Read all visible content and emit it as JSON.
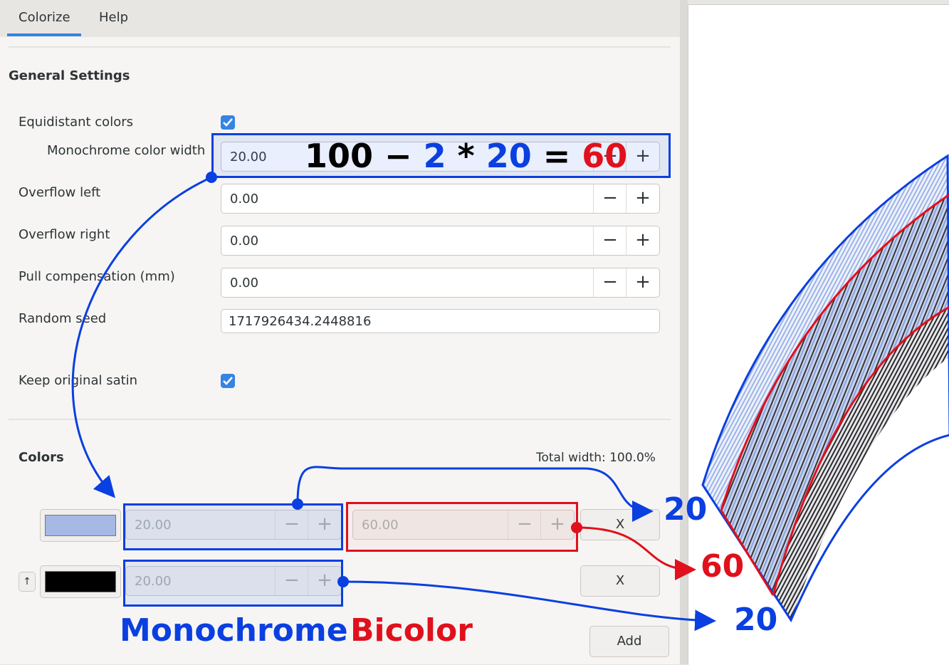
{
  "tabs": [
    {
      "label": "Colorize"
    },
    {
      "label": "Help"
    }
  ],
  "general": {
    "heading": "General Settings",
    "equidistant_label": "Equidistant colors",
    "mono_width_label": "Monochrome color width",
    "mono_width_value": "20.00",
    "overflow_left_label": "Overflow left",
    "overflow_left_value": "0.00",
    "overflow_right_label": "Overflow right",
    "overflow_right_value": "0.00",
    "pull_comp_label": "Pull compensation (mm)",
    "pull_comp_value": "0.00",
    "random_seed_label": "Random seed",
    "random_seed_value": "1717926434.2448816",
    "keep_satin_label": "Keep original satin"
  },
  "colors": {
    "heading": "Colors",
    "total_width": "Total width: 100.0%",
    "rows": [
      {
        "swatch": "#a6b8e4",
        "mono_value": "20.00",
        "bicolor_value": "60.00",
        "remove_label": "X"
      },
      {
        "swatch": "#000000",
        "mono_value": "20.00",
        "remove_label": "X",
        "up_label": "↑"
      }
    ],
    "add_label": "Add"
  },
  "spin_buttons": {
    "minus": "−",
    "plus": "+"
  },
  "annotations": {
    "formula": {
      "a": "100 − ",
      "b": "2",
      "c": " * ",
      "d": "20",
      "e": " = ",
      "f": "60"
    },
    "n_top": "20",
    "n_mid": "60",
    "n_bottom": "20",
    "mono_caption": "Monochrome",
    "bicolor_caption": "Bicolor",
    "blue": "#0a3fe0",
    "red": "#e0101c"
  }
}
